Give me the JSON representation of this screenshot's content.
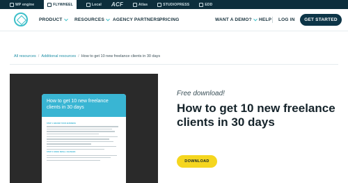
{
  "brandbar": {
    "items": [
      {
        "label": "WP engine"
      },
      {
        "label": "FLYWHEEL"
      },
      {
        "label": "Local"
      },
      {
        "label": "ACF"
      },
      {
        "label": "Atlas"
      },
      {
        "label": "STUDIOPRESS"
      },
      {
        "label": "EDD"
      }
    ]
  },
  "nav": {
    "product": "PRODUCT",
    "resources": "RESOURCES",
    "agency_partners": "AGENCY PARTNERS",
    "pricing": "PRICING",
    "demo": "WANT A DEMO?",
    "help": "HELP",
    "login": "LOG IN",
    "cta": "GET STARTED"
  },
  "breadcrumb": {
    "items": [
      "All resources",
      "Additional resources",
      "How to get 10 new freelance clients in 30 days"
    ],
    "separator": "/"
  },
  "preview": {
    "doc_title": "How to get 10 new freelance clients in 30 days",
    "sections": [
      "STEP 1: BRAND YOUR BUSINESS",
      "STEP 2: MAKE SMALL CHANGES"
    ]
  },
  "main": {
    "eyebrow": "Free download!",
    "title": "How to get 10 new freelance clients in 30 days",
    "download_label": "DOWNLOAD"
  },
  "colors": {
    "brandbar_bg": "#0d2e3c",
    "accent_teal": "#3dbfc9",
    "cta_bg": "#0d3547",
    "download_bg": "#f5d61f",
    "doc_header": "#39b5d3"
  },
  "icons": {
    "logo": "flywheel-logo-icon",
    "chevron": "chevron-down-icon"
  }
}
